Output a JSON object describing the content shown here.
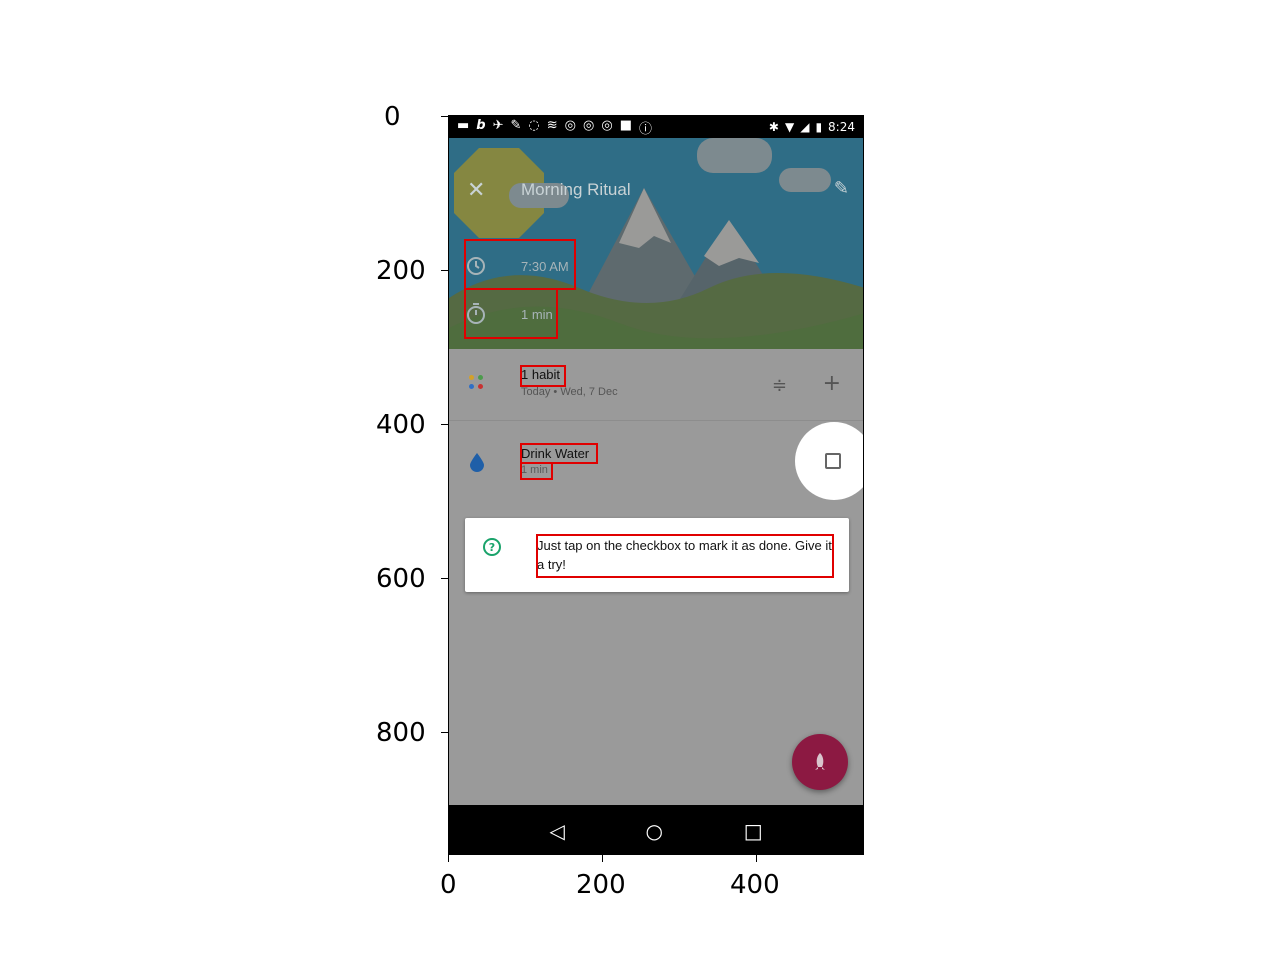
{
  "axes": {
    "y_ticks": [
      "0",
      "200",
      "400",
      "600",
      "800"
    ],
    "x_ticks": [
      "0",
      "200",
      "400"
    ]
  },
  "status_bar": {
    "time": "8:24"
  },
  "toolbar": {
    "title": "Morning Ritual",
    "close_icon": "close-icon",
    "edit_icon": "edit-icon"
  },
  "ritual_info": {
    "alarm_time": "7:30 AM",
    "duration": "1 min"
  },
  "habits_header": {
    "title": "1 habit",
    "subtitle": "Today • Wed, 7 Dec"
  },
  "habits": [
    {
      "name": "Drink Water",
      "duration": "1 min",
      "icon": "water-drop-icon",
      "checked": false
    }
  ],
  "tip": {
    "text": "Just tap on the checkbox to mark it as done. Give it a try!"
  },
  "colors": {
    "accent_fab": "#8c1942",
    "tip_icon": "#1aa36b",
    "highlight_box": "#e00000"
  }
}
